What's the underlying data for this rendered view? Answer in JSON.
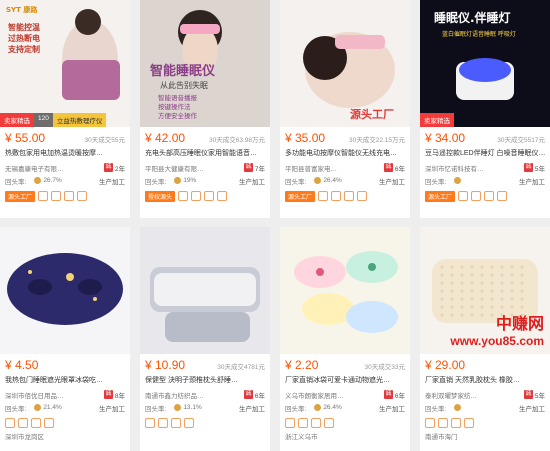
{
  "cards": [
    {
      "image": {
        "headline": "智能控温\n过热断电\n支持定制",
        "tag": "卖家精选",
        "extra": "120",
        "bottom_label": "立益热敷理疗仪",
        "theme": "white"
      },
      "price": "¥ 55.00",
      "sold": "30天成交55元",
      "title": "热敷包家用电加热温烫暖按摩…",
      "supplier": "无锡嘉康电子有限…",
      "years": "2年",
      "rating": "26.7%",
      "stat": "",
      "prod": "生产加工",
      "tags": [
        "源头工厂"
      ]
    },
    {
      "image": {
        "headline": "智能睡眠仪",
        "sub": "从此告别失眠",
        "bullets": [
          "智能语音播报",
          "按键操作法",
          "方便安全操作"
        ],
        "theme": "gray"
      },
      "price": "¥ 42.00",
      "sold": "30天成交63.98万元",
      "title": "充电头部高压睡眠仪家用智能语音…",
      "supplier": "平阳县大健康有限…",
      "years": "7年",
      "rating": "19%",
      "stat": "",
      "prod": "生产加工",
      "tags": [
        "授权源头"
      ]
    },
    {
      "image": {
        "headline": "源头工厂",
        "theme": "white"
      },
      "price": "¥ 35.00",
      "sold": "30天成交22.15万元",
      "title": "多功能电动按摩仪智能仪无线充电…",
      "supplier": "平阳县普富家电…",
      "years": "6年",
      "rating": "26.4%",
      "stat": "",
      "prod": "生产加工",
      "tags": [
        "源头工厂"
      ]
    },
    {
      "image": {
        "headline": "睡眠仪.伴睡灯",
        "sub": "蓝白催眠灯语音睡眠 呼吸灯",
        "tag": "卖家精选",
        "theme": "dark"
      },
      "price": "¥ 34.00",
      "sold": "30天成交5517元",
      "title": "豆马遥控款LED伴睡灯 白噪音睡眠仪…",
      "supplier": "深圳市忆诺科技有…",
      "years": "5年",
      "rating": "",
      "stat": "",
      "prod": "生产加工",
      "tags": [
        "源头工厂"
      ]
    },
    {
      "image": {
        "theme": "mask"
      },
      "price": "¥ 4.50",
      "sold": "",
      "title": "我热包门睡眠遮光眼罩冰袋吃…",
      "supplier": "深圳市佰优日用品…",
      "years": "8年",
      "rating": "21.4%",
      "stat": "",
      "prod": "生产加工",
      "tags": [],
      "location": "深圳市龙岗区"
    },
    {
      "image": {
        "theme": "pillow"
      },
      "price": "¥ 10.90",
      "sold": "30天成交4781元",
      "title": "保健型 決明子颈椎枕头舒睡…",
      "supplier": "南通市鑫力纺织品…",
      "years": "6年",
      "rating": "13.1%",
      "stat": "",
      "prod": "生产加工",
      "tags": []
    },
    {
      "image": {
        "theme": "masks"
      },
      "price": "¥ 2.20",
      "sold": "30天成交33元",
      "title": "厂家直销冰袋可爱卡通动物遮光…",
      "supplier": "义乌市朗衡家居用…",
      "years": "6年",
      "rating": "26.4%",
      "stat": "",
      "prod": "生产加工",
      "tags": [],
      "location": "浙江义乌市"
    },
    {
      "image": {
        "theme": "latex",
        "watermark_a": "中赚网",
        "watermark_b": "www.you85.com"
      },
      "price": "¥ 29.00",
      "sold": "",
      "title": "厂家直销 天然乳胶枕头 橡胶…",
      "supplier": "泰利双曜梦家纺…",
      "years": "5年",
      "rating": "",
      "stat": "",
      "prod": "生产加工",
      "tags": [],
      "location": "南通市海门"
    }
  ]
}
